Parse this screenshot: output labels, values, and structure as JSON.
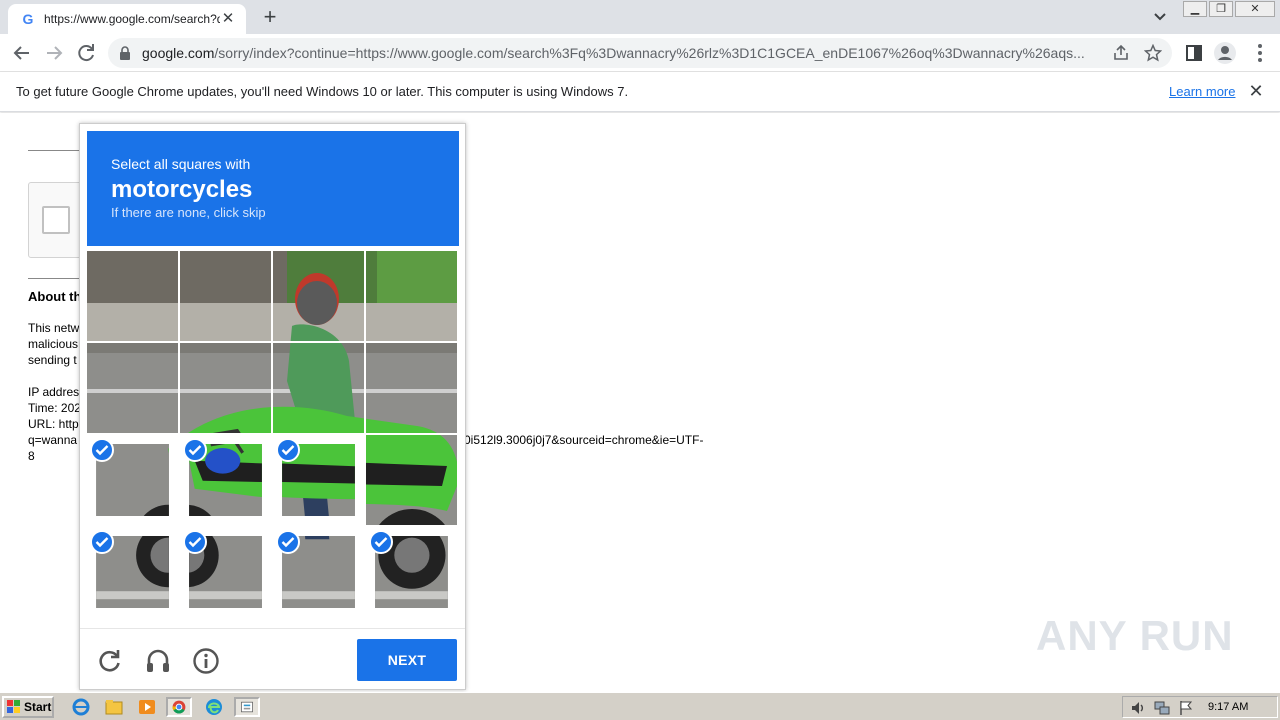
{
  "browser": {
    "tab_title": "https://www.google.com/search?q=",
    "url_host": "google.com",
    "url_rest": "/sorry/index?continue=https://www.google.com/search%3Fq%3Dwannacry%26rlz%3D1C1GCEA_enDE1067%26oq%3Dwannacry%26aqs...",
    "accent": "#1a73e8"
  },
  "infobar": {
    "message": "To get future Google Chrome updates, you'll need Windows 10 or later. This computer is using Windows 7.",
    "link": "Learn more"
  },
  "page": {
    "about_heading": "About th",
    "para1": [
      "This netw",
      "malicious",
      "sending t"
    ],
    "para2": [
      "IP addres",
      "Time: 202",
      "URL: http",
      "q=wanna",
      "8"
    ],
    "url_tail": "0i512l9.3006j0j7&sourceid=chrome&ie=UTF-"
  },
  "captcha": {
    "instruction": "Select all squares with",
    "target": "motorcycles",
    "hint": "If there are none, click skip",
    "next_label": "NEXT",
    "selected_tiles": [
      8,
      9,
      10,
      12,
      13,
      14,
      15
    ]
  },
  "watermark": "ANY RUN",
  "taskbar": {
    "start_label": "Start",
    "clock": "9:17 AM"
  }
}
